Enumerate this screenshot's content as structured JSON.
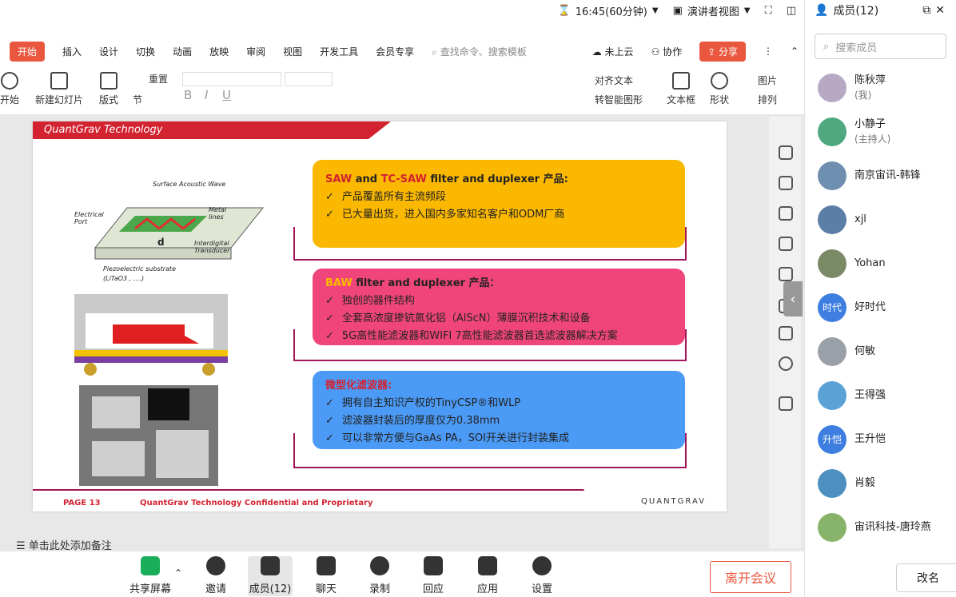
{
  "top": {
    "time": "16:45(60分钟)",
    "presenter_view": "演讲者视图"
  },
  "members_panel": {
    "title": "成员(12)",
    "search_placeholder": "搜索成员",
    "rename_label": "改名",
    "list": [
      {
        "name": "陈秋萍",
        "sub": "(我)",
        "color": "#b7a9c4",
        "initial": ""
      },
      {
        "name": "小静子",
        "sub": "(主持人)",
        "color": "#4fa87f",
        "initial": ""
      },
      {
        "name": "南京宙讯-韩锋",
        "sub": "",
        "color": "#6f8fb0",
        "initial": ""
      },
      {
        "name": "xjl",
        "sub": "",
        "color": "#5b7ea6",
        "initial": ""
      },
      {
        "name": "Yohan",
        "sub": "",
        "color": "#7a8a66",
        "initial": ""
      },
      {
        "name": "好时代",
        "sub": "",
        "color": "#3d7ee0",
        "initial": "时代"
      },
      {
        "name": "何敏",
        "sub": "",
        "color": "#9aa0a8",
        "initial": ""
      },
      {
        "name": "王得强",
        "sub": "",
        "color": "#5aa1d6",
        "initial": ""
      },
      {
        "name": "王升恺",
        "sub": "",
        "color": "#3d7ee0",
        "initial": "升恺"
      },
      {
        "name": "肖毅",
        "sub": "",
        "color": "#4d8fbf",
        "initial": ""
      },
      {
        "name": "宙讯科技-唐玲燕",
        "sub": "",
        "color": "#88b36b",
        "initial": ""
      }
    ]
  },
  "ribbon": {
    "tabs": [
      "开始",
      "插入",
      "设计",
      "切换",
      "动画",
      "放映",
      "审阅",
      "视图",
      "开发工具",
      "会员专享"
    ],
    "search": "查找命令、搜索模板",
    "cloud": "未上云",
    "collab": "协作",
    "share": "分享",
    "tools": [
      "开始",
      "新建幻灯片",
      "版式",
      "节",
      "重置",
      "文本框",
      "形状",
      "排列",
      "图片",
      "对齐文本",
      "转智能图形"
    ]
  },
  "slide": {
    "header": "QuantGrav Technology",
    "box1": {
      "title_prefix": "SAW",
      "title_and": " and ",
      "title_tc": "TC-SAW",
      "title_rest": " filter and duplexer 产品:",
      "items": [
        "产品覆盖所有主流频段",
        "已大量出货，进入国内多家知名客户和ODM厂商"
      ]
    },
    "box2": {
      "title_prefix": "BAW",
      "title_rest": " filter and duplexer 产品：",
      "items": [
        "独创的器件结构",
        "全套高浓度掺钪氮化铝（AlScN）薄膜沉积技术和设备",
        "5G高性能滤波器和WIFI 7高性能滤波器首选滤波器解决方案"
      ]
    },
    "box3": {
      "title": "微型化滤波器:",
      "items": [
        "拥有自主知识产权的TinyCSP®和WLP",
        "滤波器封装后的厚度仅为0.38mm",
        "可以非常方便与GaAs PA，SOI开关进行封装集成"
      ]
    },
    "diagram_labels": {
      "saw": "Surface Acoustic Wave",
      "port": "Electrical Port",
      "metal": "Metal lines",
      "idt": "Interdigital Transducer",
      "substrate": "Piezoelectric substrate",
      "material": "(LiTaO3 , ....)",
      "d": "d"
    },
    "footer_page": "PAGE 13",
    "footer_conf": "QuantGrav Technology  Confidential and Proprietary",
    "footer_logo": "QUANTGRAV"
  },
  "notes": "单击此处添加备注",
  "bottom": {
    "share_screen": "共享屏幕",
    "invite": "邀请",
    "members": "成员(12)",
    "chat": "聊天",
    "record": "录制",
    "reaction": "回应",
    "apps": "应用",
    "settings": "设置",
    "leave": "离开会议"
  },
  "colors": {
    "accent": "#e9573f",
    "box1": "#fbb800",
    "box2": "#f0457b",
    "box3": "#4b9af5",
    "brand_red": "#d32230"
  }
}
